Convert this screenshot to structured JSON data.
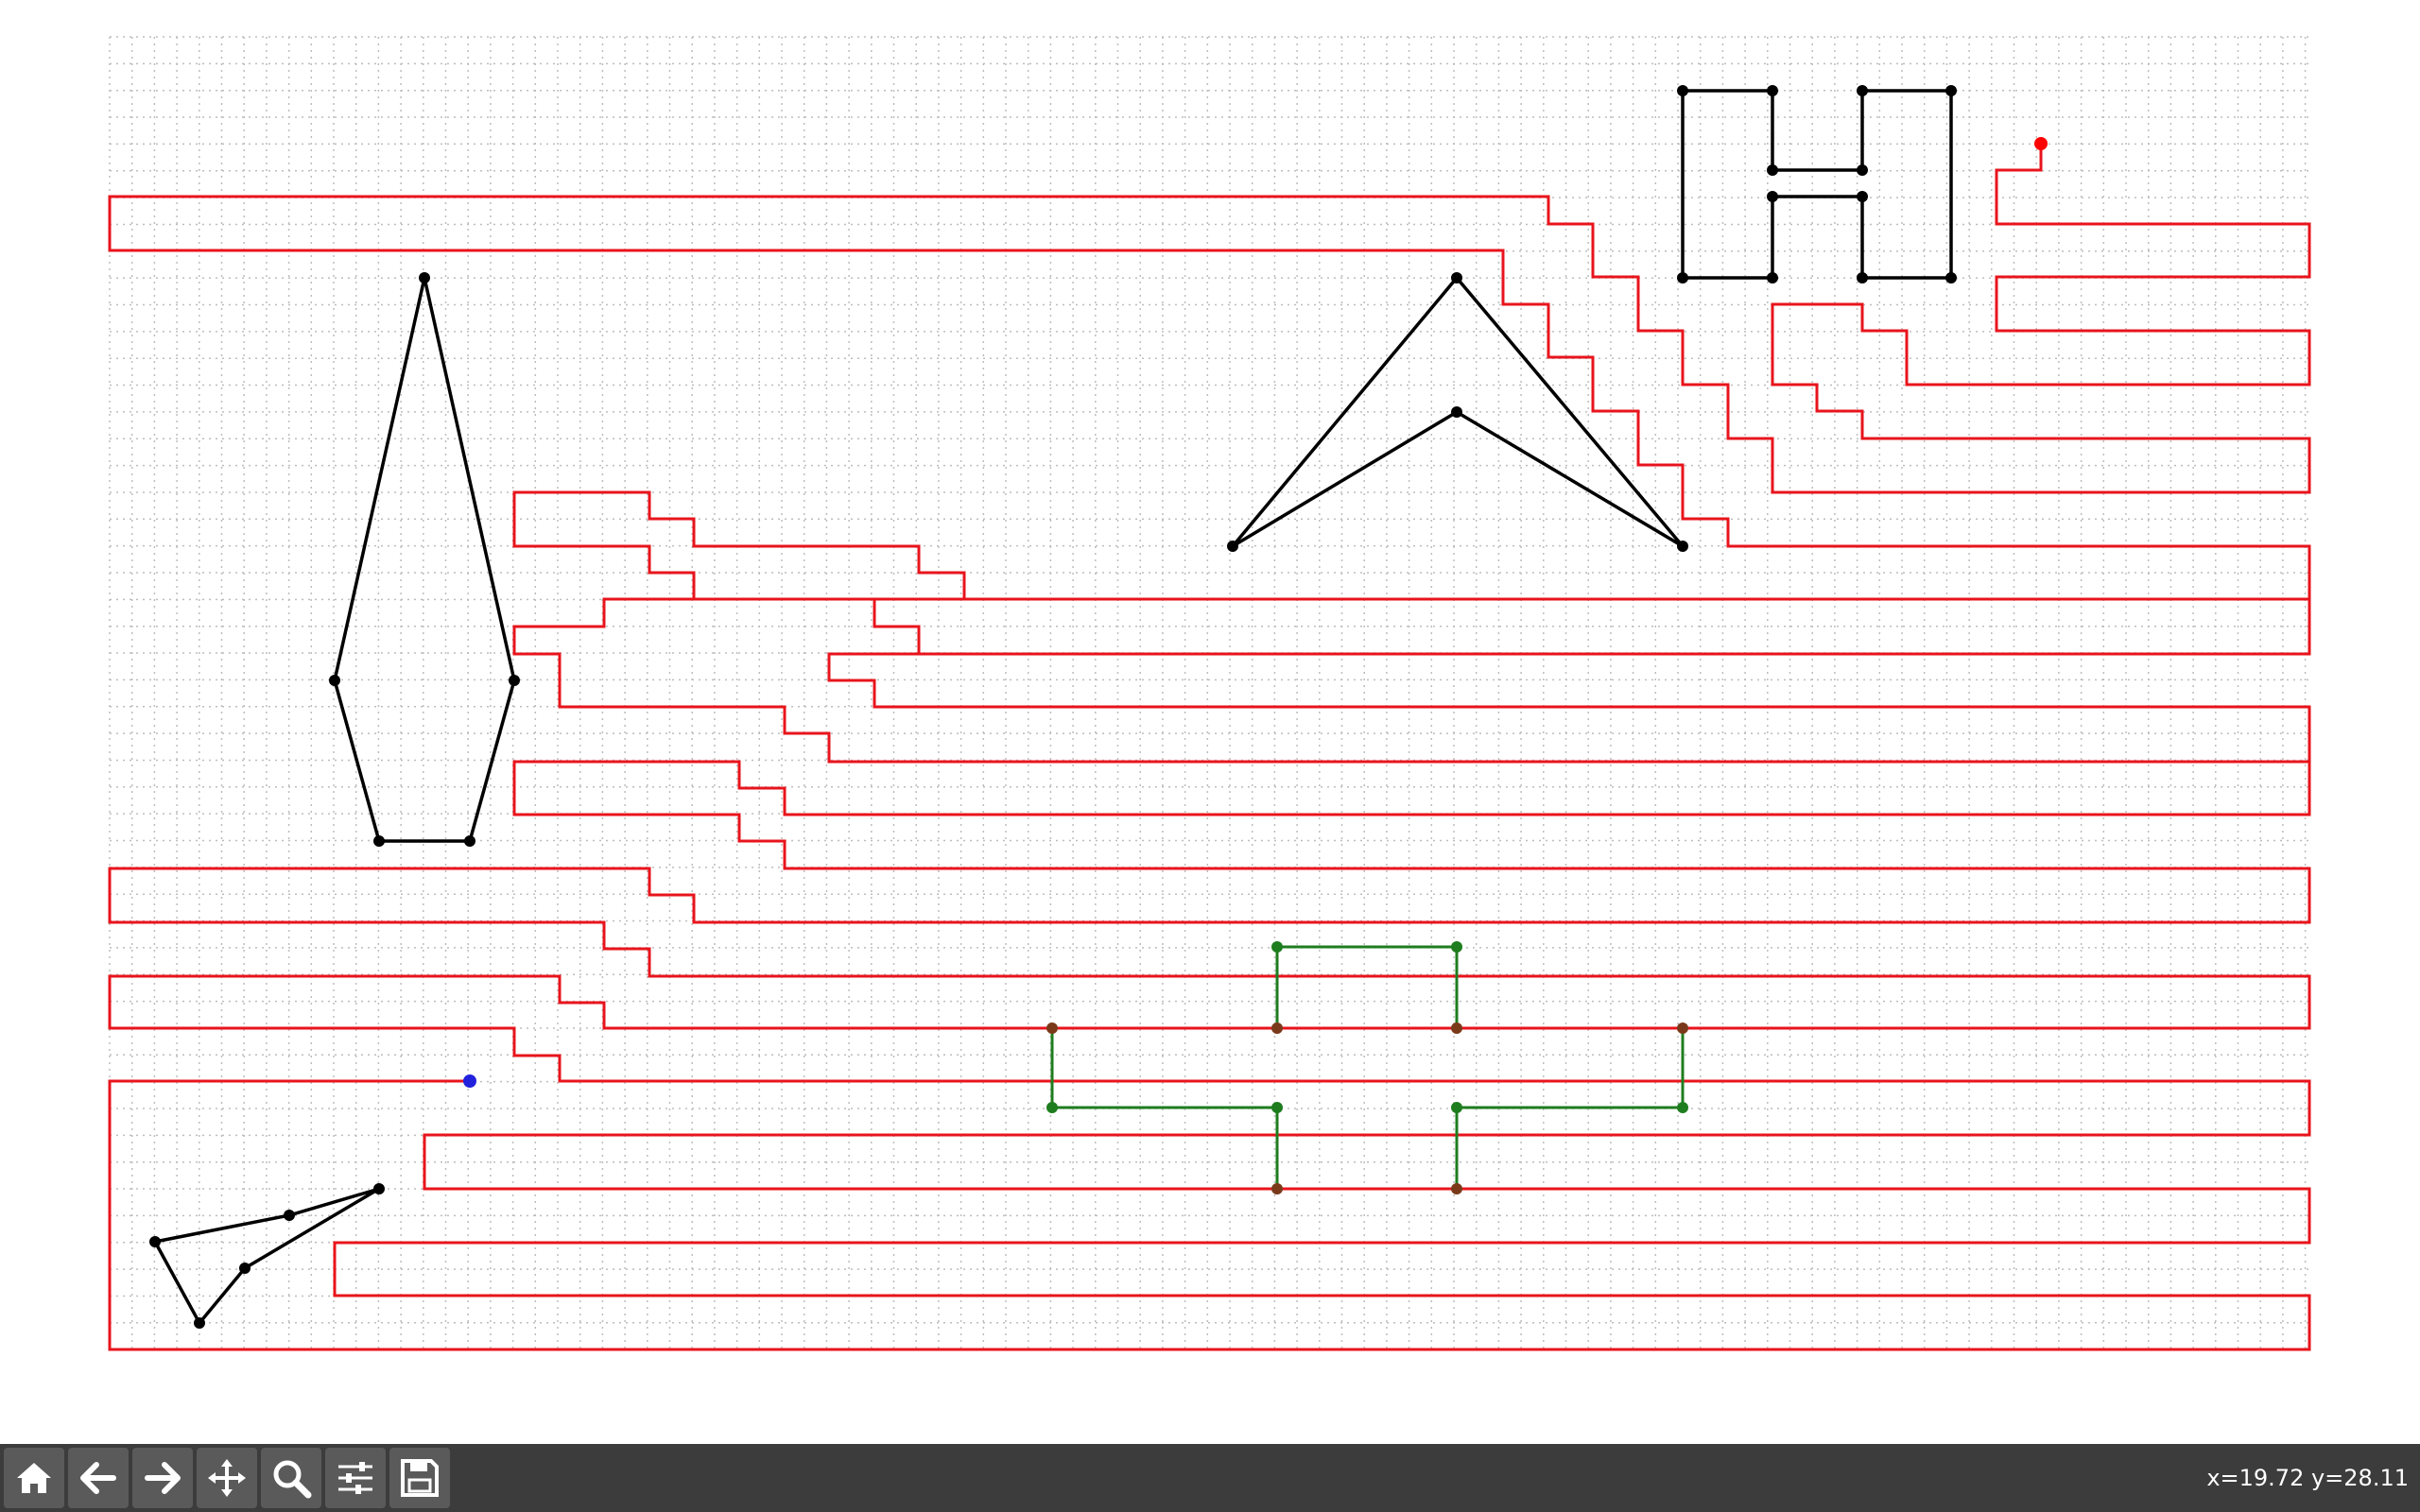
{
  "toolbar": {
    "buttons": [
      {
        "name": "home-button",
        "icon": "home-icon"
      },
      {
        "name": "back-button",
        "icon": "arrow-left-icon"
      },
      {
        "name": "forward-button",
        "icon": "arrow-right-icon"
      },
      {
        "name": "pan-button",
        "icon": "move-icon"
      },
      {
        "name": "zoom-button",
        "icon": "magnifier-icon"
      },
      {
        "name": "configure-subplots-button",
        "icon": "sliders-icon"
      },
      {
        "name": "save-button",
        "icon": "floppy-disk-icon"
      }
    ],
    "coordinates": "x=19.72 y=28.11"
  },
  "colors": {
    "path": "#e8141c",
    "shape": "#000000",
    "obstacle": "#1e7d1e",
    "start": "#ff0000",
    "end": "#2222dd",
    "grid": "#bdbdbd",
    "toolbar_bg": "#3c3c3c",
    "button_bg": "#5a5a5a"
  },
  "plot": {
    "grid": true,
    "x_range": [
      0,
      49
    ],
    "y_range": [
      0,
      49
    ]
  }
}
